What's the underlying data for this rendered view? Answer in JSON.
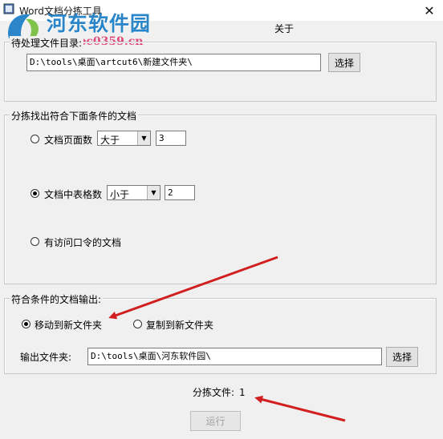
{
  "window": {
    "title": "Word文档分拣工具",
    "close_glyph": "✕"
  },
  "watermark": {
    "site_name": "河东软件园",
    "url": "www.pc0359.cn"
  },
  "menu": {
    "about": "关于"
  },
  "source_group": {
    "legend": "待处理文件目录:",
    "path_value": "D:\\tools\\桌面\\artcut6\\新建文件夹\\",
    "browse_label": "选择"
  },
  "filter_group": {
    "legend": "分拣找出符合下面条件的文档",
    "pages": {
      "label": "文档页面数",
      "selected": false,
      "operator": "大于",
      "value": "3"
    },
    "tables": {
      "label": "文档中表格数",
      "selected": true,
      "operator": "小于",
      "value": "2"
    },
    "password": {
      "label": "有访问口令的文档",
      "selected": false
    }
  },
  "output_group": {
    "legend": "符合条件的文档输出:",
    "move_label": "移动到新文件夹",
    "move_selected": true,
    "copy_label": "复制到新文件夹",
    "copy_selected": false,
    "folder_label": "输出文件夹:",
    "folder_value": "D:\\tools\\桌面\\河东软件园\\",
    "browse_label": "选择"
  },
  "result": {
    "label": "分拣文件:",
    "count": "1"
  },
  "run_button": {
    "label": "运行",
    "enabled": false
  },
  "colors": {
    "annotation_arrow": "#d11f1f",
    "watermark_blue": "#2a86c8",
    "watermark_pink": "#e04b7a"
  }
}
